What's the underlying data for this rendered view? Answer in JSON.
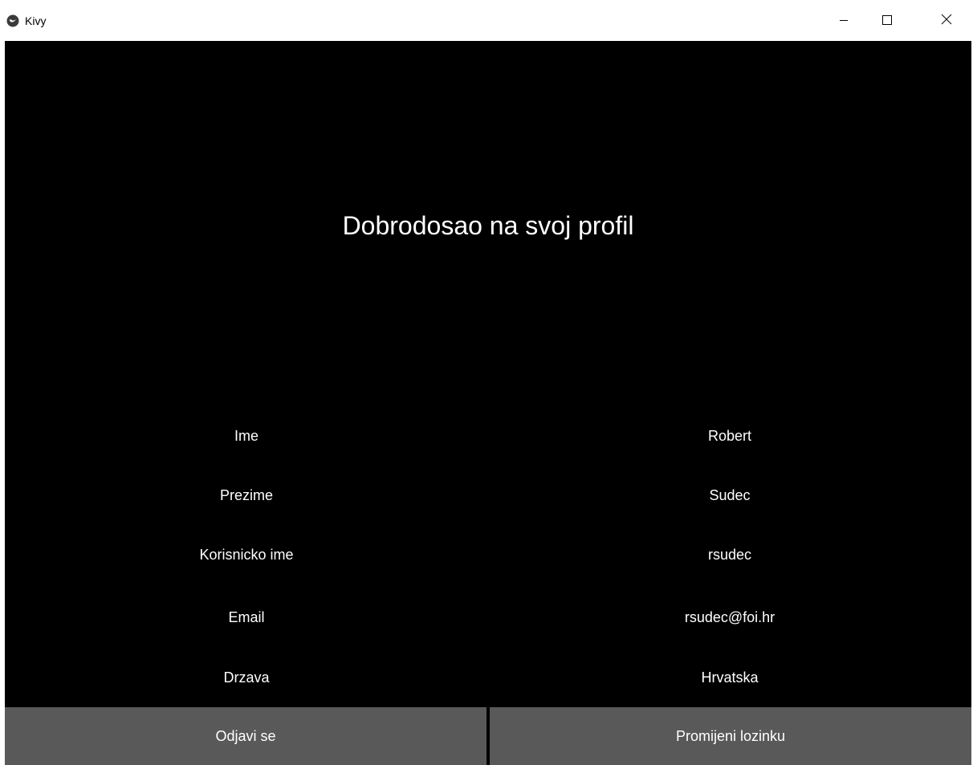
{
  "window": {
    "title": "Kivy",
    "icons": {
      "app": "kivy-logo-icon",
      "minimize": "minimize-icon",
      "maximize": "maximize-icon",
      "close": "close-icon"
    }
  },
  "profile": {
    "heading": "Dobrodosao na svoj profil",
    "fields": [
      {
        "label": "Ime",
        "value": "Robert"
      },
      {
        "label": "Prezime",
        "value": "Sudec"
      },
      {
        "label": "Korisnicko ime",
        "value": "rsudec"
      },
      {
        "label": "Email",
        "value": "rsudec@foi.hr"
      },
      {
        "label": "Drzava",
        "value": "Hrvatska"
      }
    ]
  },
  "actions": {
    "logout_label": "Odjavi se",
    "change_password_label": "Promijeni lozinku"
  },
  "colors": {
    "background": "#000000",
    "text": "#ffffff",
    "button": "#595959",
    "titlebar": "#ffffff"
  }
}
